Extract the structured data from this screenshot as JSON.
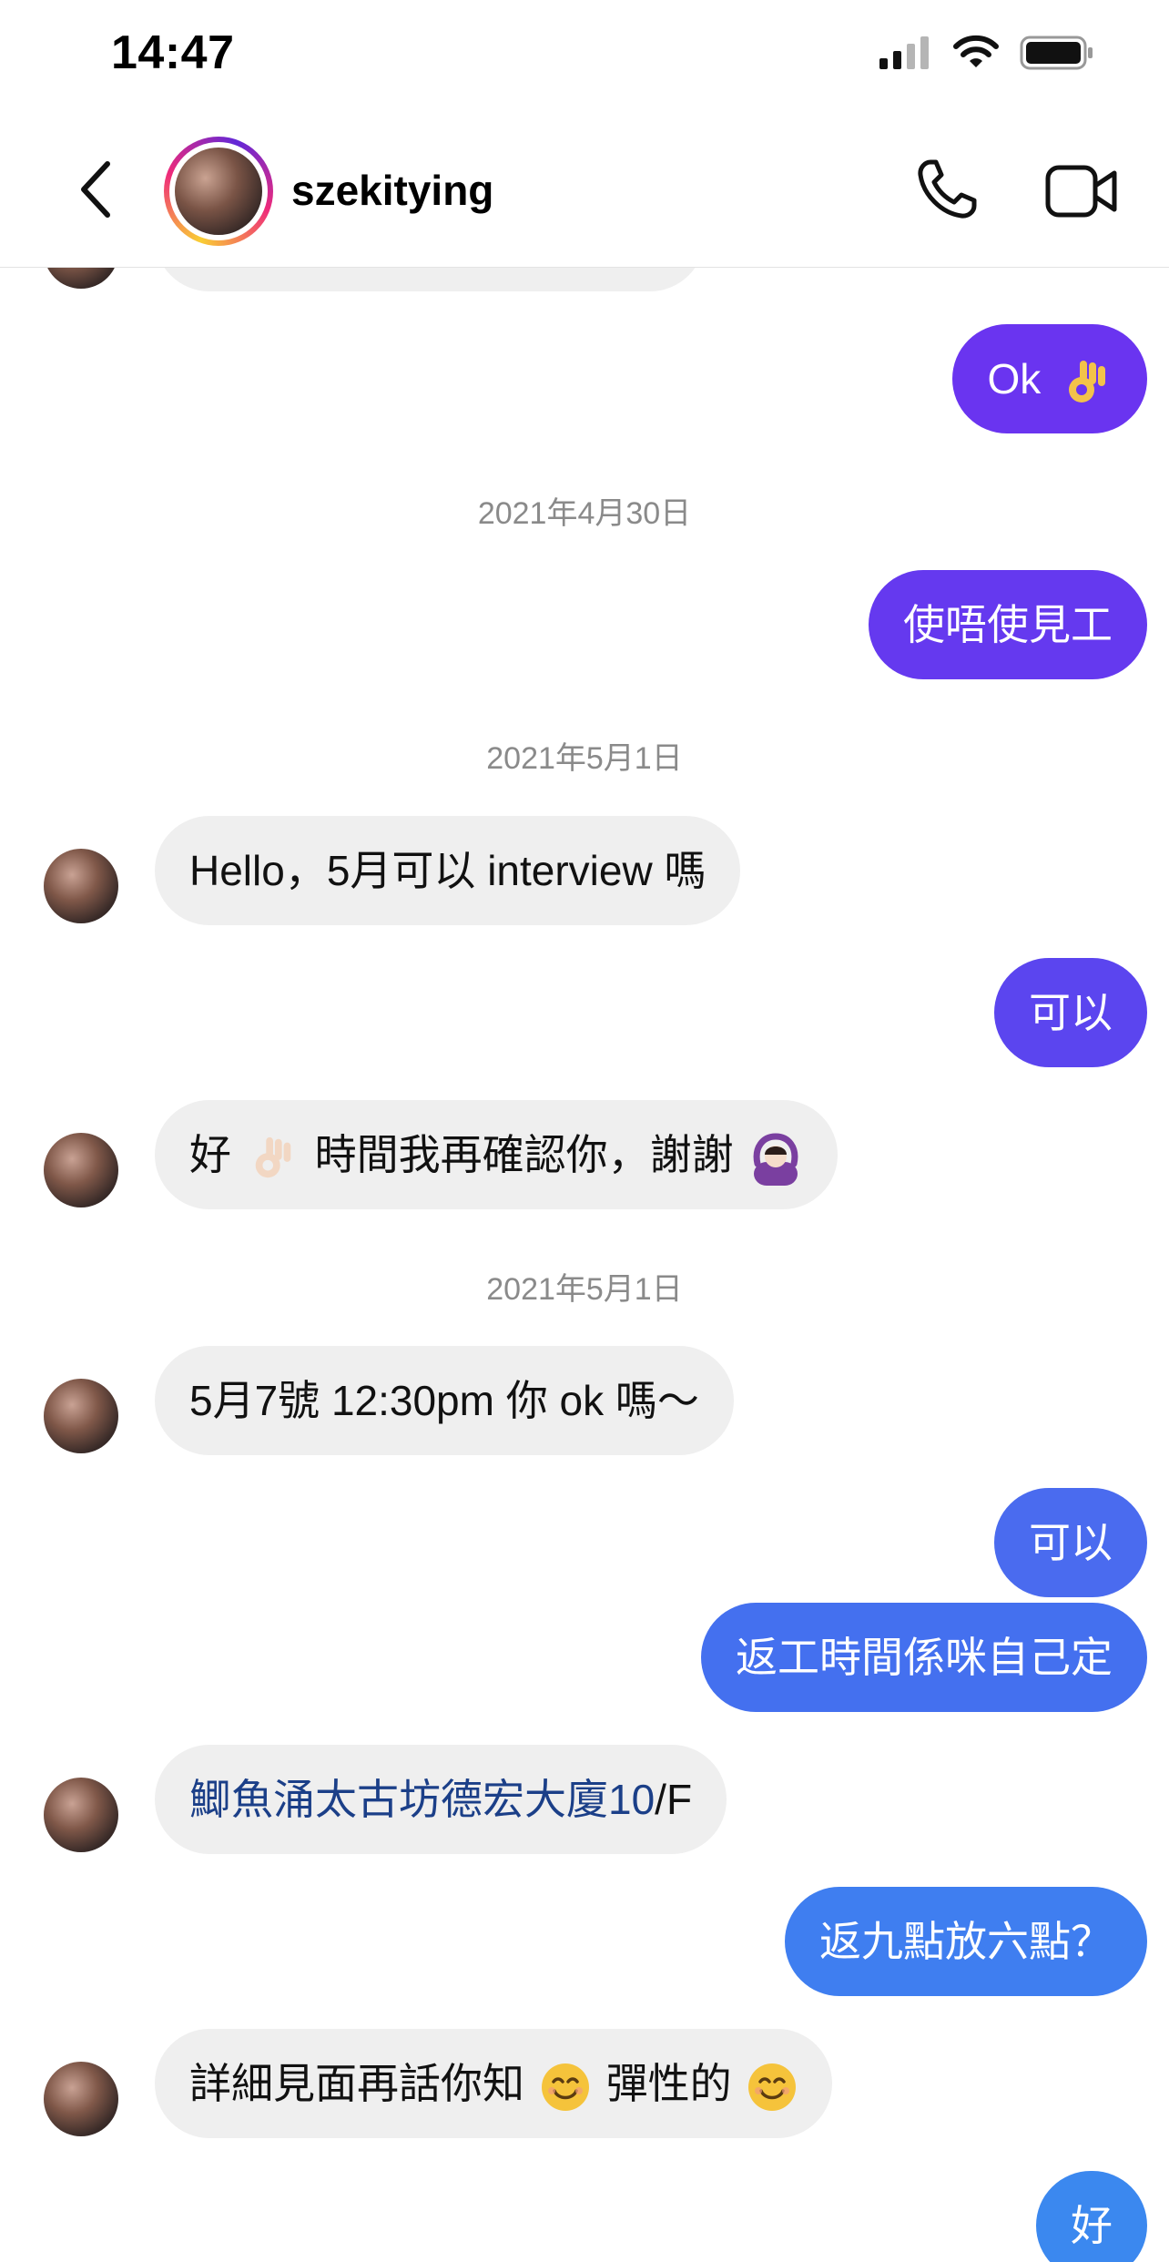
{
  "status_bar": {
    "time": "14:47"
  },
  "header": {
    "username": "szekitying"
  },
  "messages": {
    "m1": "Ok",
    "d1": "2021年4月30日",
    "m2": "使唔使見工",
    "d2": "2021年5月1日",
    "m3": "Hello，5月可以 interview 嗎",
    "m4": "可以",
    "m5_a": "好",
    "m5_b": "時間我再確認你，謝謝",
    "d3": "2021年5月1日",
    "m6": "5月7號 12:30pm 你 ok 嗎～",
    "m7": "可以",
    "m8": "返工時間係咪自己定",
    "m9_link": "鯽魚涌太古坊德宏大廈10",
    "m9_rest": "/F",
    "m10": "返九點放六點？",
    "m11_a": "詳細見面再話你知",
    "m11_b": "彈性的",
    "m12": "好"
  },
  "colors": {
    "incoming_bubble": "#efefef",
    "outgoing_top": "#6b34f0",
    "outgoing_bottom": "#3f7ff0",
    "link": "#1b3f88"
  },
  "icons": [
    "signal-icon",
    "wifi-icon",
    "battery-icon",
    "back-chevron-icon",
    "phone-call-icon",
    "video-call-icon",
    "ok-hand-emoji",
    "arms-circle-emoji",
    "smile-emoji"
  ]
}
